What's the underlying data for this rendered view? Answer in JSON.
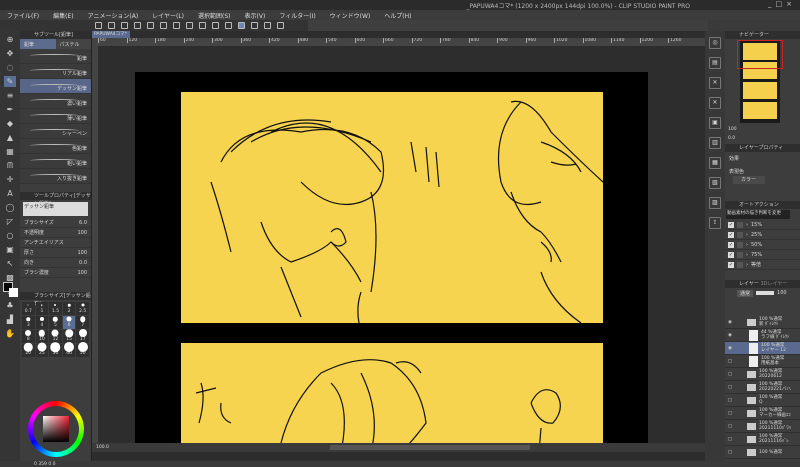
{
  "app": {
    "title": "_PAPUWA4コマ* (1200 x 2400px 144dpi 100.0%)  - CLIP STUDIO PAINT PRO",
    "window_buttons": [
      "_",
      "□",
      "×"
    ]
  },
  "menu": [
    "ファイル(F)",
    "編集(E)",
    "アニメーション(A)",
    "レイヤー(L)",
    "選択範囲(S)",
    "表示(V)",
    "フィルター(I)",
    "ウィンドウ(W)",
    "ヘルプ(H)"
  ],
  "subtool": {
    "header": "サブツール[鉛筆]",
    "tabs": [
      "鉛筆",
      "パステル"
    ],
    "brushes": [
      {
        "label": "鉛筆",
        "active": false
      },
      {
        "label": "リアル鉛筆",
        "active": false
      },
      {
        "label": "デッサン鉛筆",
        "active": true
      },
      {
        "label": "濃い鉛筆",
        "active": false
      },
      {
        "label": "薄い鉛筆",
        "active": false
      },
      {
        "label": "シャーペン",
        "active": false
      },
      {
        "label": "色鉛筆",
        "active": false
      },
      {
        "label": "粗い鉛筆",
        "active": false
      },
      {
        "label": "入り抜き鉛筆",
        "active": false
      }
    ]
  },
  "tool_property": {
    "header": "ツールプロパティ[デッサン鉛筆]",
    "preview_label": "デッサン鉛筆",
    "props": [
      {
        "label": "ブラシサイズ",
        "value": "6.0"
      },
      {
        "label": "不透明度",
        "value": "100"
      },
      {
        "label": "アンチエイリアス",
        "value": ""
      },
      {
        "label": "厚さ",
        "value": "100"
      },
      {
        "label": "向き",
        "value": "0.0"
      },
      {
        "label": "ブラシ濃度",
        "value": "100"
      }
    ]
  },
  "brush_size": {
    "header": "ブラシサイズ[デッサン鉛筆]",
    "sizes": [
      "0.7",
      "1",
      "1.5",
      "2",
      "2.5",
      "3",
      "4",
      "5",
      "6",
      "7",
      "8",
      "10",
      "12",
      "15",
      "17",
      "20",
      "25",
      "30",
      "40",
      "50"
    ],
    "selected": "6"
  },
  "color": {
    "main": "#000000",
    "sub": "#ffffff",
    "readout": "0  359  0  0"
  },
  "document": {
    "tab": "PAPUWA4コマ*",
    "ruler_ticks": [
      "60",
      "120",
      "180",
      "240",
      "300",
      "360",
      "420",
      "480",
      "540",
      "600",
      "660",
      "720",
      "780",
      "840",
      "900",
      "960",
      "1020",
      "1080",
      "1140",
      "1200",
      "1260"
    ],
    "zoom": "100.0",
    "canvas_colors": {
      "panel": "#f6d44f",
      "page": "#000000",
      "ink": "#111111"
    }
  },
  "navigator": {
    "tab": "ナビゲーター",
    "zoom_value": "100",
    "rotate_value": "0.0"
  },
  "layer_property": {
    "tab": "レイヤープロパティ",
    "effect_label": "効果",
    "display_color_label": "表現色",
    "display_color_value": "カラー"
  },
  "auto_action": {
    "tab": "オートアクション",
    "set": "動画素材の描き判断を変更",
    "items": [
      "15%",
      "25%",
      "50%",
      "75%",
      "等倍"
    ]
  },
  "layers": {
    "tab": "レイヤー",
    "tab2": "3Dレイヤー",
    "blend": "通常",
    "opacity": "100",
    "items": [
      {
        "l1": "100 %通常",
        "l2": "新 ﾀﾞｲﾚｸﾄ",
        "type": "folder",
        "visible": true,
        "active": false
      },
      {
        "l1": "44 %通常",
        "l2": "ラフ線 ﾀﾞｲﾚｸﾄ",
        "type": "layer",
        "visible": true,
        "active": false
      },
      {
        "l1": "100 %通常",
        "l2": "レイヤー 12",
        "type": "layer",
        "visible": true,
        "active": true
      },
      {
        "l1": "100 %通常",
        "l2": "用紙基本",
        "type": "layer",
        "visible": false,
        "active": false
      },
      {
        "l1": "100 %通常",
        "l2": "20220612",
        "type": "folder",
        "visible": false,
        "active": false
      },
      {
        "l1": "100 %通常",
        "l2": "20220221バハ",
        "type": "folder",
        "visible": false,
        "active": false
      },
      {
        "l1": "100 %通常",
        "l2": "Q",
        "type": "folder",
        "visible": false,
        "active": false
      },
      {
        "l1": "100 %通常",
        "l2": "マーカー線画ｴｺ",
        "type": "folder",
        "visible": false,
        "active": false
      },
      {
        "l1": "100 %通常",
        "l2": "20211110ﾊﾟﾜﾊ",
        "type": "folder",
        "visible": false,
        "active": false
      },
      {
        "l1": "100 %通常",
        "l2": "20211116ﾊﾞﾚ",
        "type": "folder",
        "visible": false,
        "active": false
      },
      {
        "l1": "100 %通常",
        "l2": "",
        "type": "folder",
        "visible": false,
        "active": false
      }
    ]
  }
}
